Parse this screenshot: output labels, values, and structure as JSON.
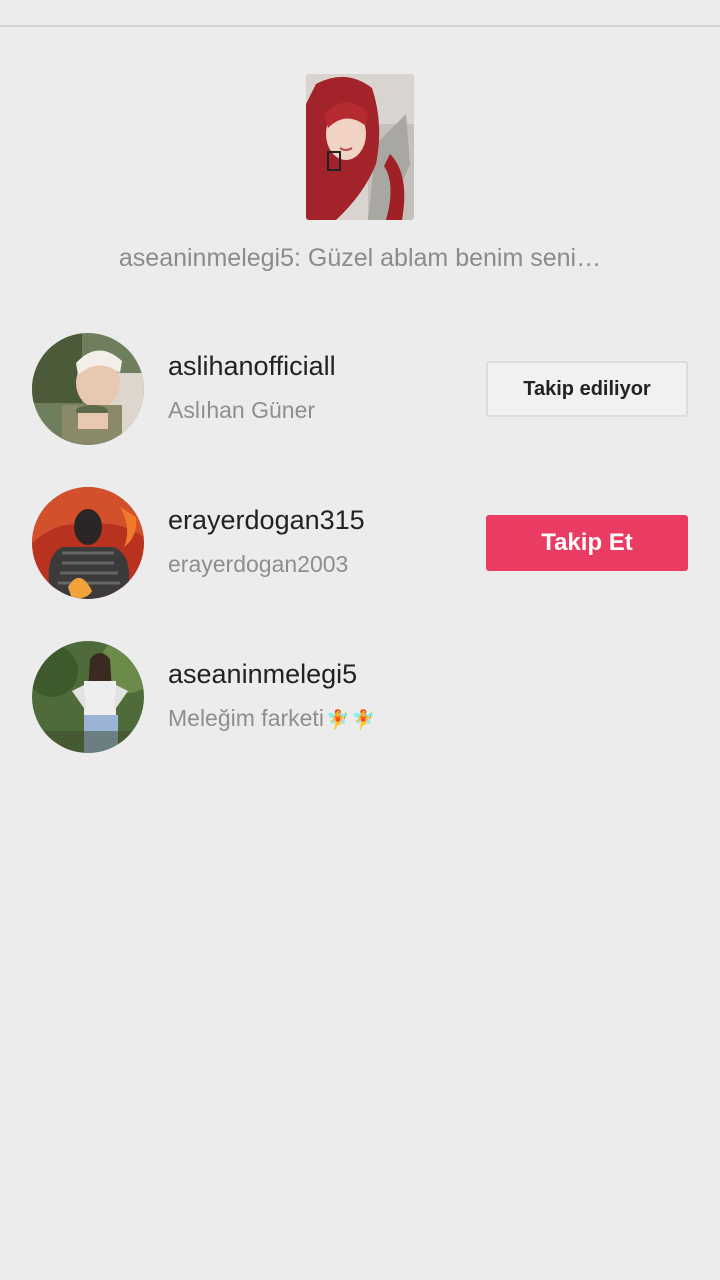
{
  "video": {
    "comment_text": "aseaninmelegi5: Güzel ablam benim seni…"
  },
  "users": [
    {
      "username": "aslihanofficiall",
      "subtitle": "Aslıhan Güner",
      "button_label": "Takip ediliyor"
    },
    {
      "username": "erayerdogan315",
      "subtitle": "erayerdogan2003",
      "button_label": "Takip Et"
    },
    {
      "username": "aseaninmelegi5",
      "subtitle": "Meleğim farketi",
      "subtitle_icons": [
        "fairy-icon",
        "fairy-icon"
      ]
    }
  ],
  "colors": {
    "background": "#ececec",
    "follow_button": "#ea3b62",
    "following_button": "#f1f1f1"
  }
}
